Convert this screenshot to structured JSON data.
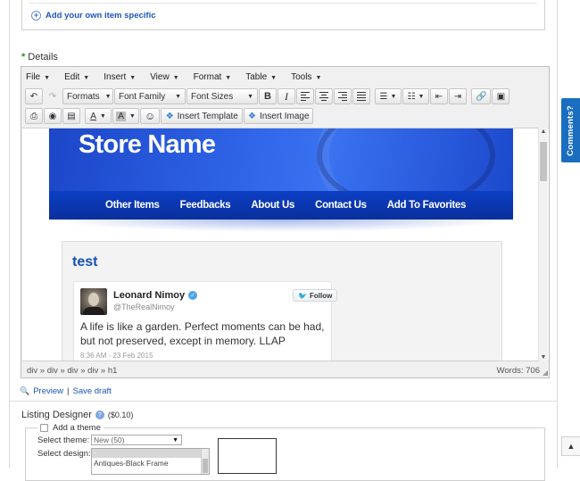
{
  "top_section": {
    "add_item_specific": "Add your own item specific"
  },
  "details": {
    "label": "Details",
    "menubar": [
      "File",
      "Edit",
      "Insert",
      "View",
      "Format",
      "Table",
      "Tools"
    ],
    "toolbar": {
      "formats": "Formats",
      "font_family": "Font Family",
      "font_sizes": "Font Sizes",
      "bold": "B",
      "italic": "I",
      "insert_template": "Insert Template",
      "insert_image": "Insert Image",
      "text_color": "A",
      "bg_color": "A",
      "emoticons": "☺"
    },
    "content": {
      "store_name": "Store Name",
      "nav": [
        "Other Items",
        "Feedbacks",
        "About Us",
        "Contact Us",
        "Add To Favorites"
      ],
      "panel_title": "test",
      "tweet": {
        "name": "Leonard Nimoy",
        "handle": "@TheRealNimoy",
        "follow": "Follow",
        "text": "A life is like a garden. Perfect moments can be had, but not preserved, except in memory.  LLAP",
        "date": "8:36 AM - 23 Feb 2015"
      }
    },
    "status": {
      "path": "div » div » div » div » h1",
      "words": "Words: 706"
    }
  },
  "links": {
    "preview": "Preview",
    "separator": "|",
    "save_draft": "Save draft"
  },
  "listing_designer": {
    "label": "Listing Designer",
    "price": "($0.10)",
    "add_theme": "Add a theme",
    "select_theme_label": "Select theme:",
    "select_theme_value": "New (50)",
    "select_design_label": "Select design:",
    "design_selected": "-",
    "design_options": [
      "Antiques-Black Frame"
    ]
  },
  "side": {
    "comments": "Comments?",
    "scroll_top_icon": "chevron-up-icon"
  }
}
